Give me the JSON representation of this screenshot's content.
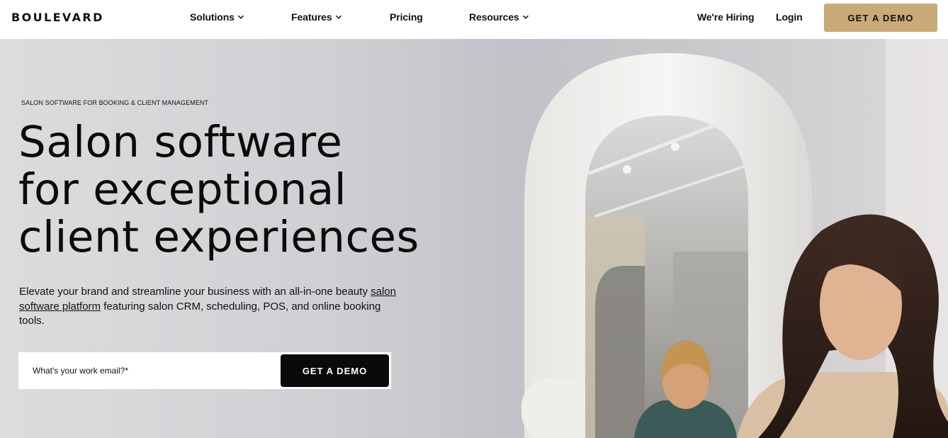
{
  "header": {
    "logo": "BOULEVARD",
    "nav": {
      "solutions": "Solutions",
      "features": "Features",
      "pricing": "Pricing",
      "resources": "Resources",
      "hiring": "We're Hiring",
      "login": "Login"
    },
    "cta": "GET A DEMO"
  },
  "hero": {
    "eyebrow": "SALON SOFTWARE FOR BOOKING & CLIENT MANAGEMENT",
    "headline": [
      "Salon software",
      "for exceptional",
      "client experiences"
    ],
    "subcopy": {
      "before_link": "Elevate your brand and streamline your business with an all-in-one beauty ",
      "link": "salon software platform",
      "after_link": " featuring salon CRM, scheduling, POS, and online booking tools."
    },
    "email_placeholder": "What's your work email?*",
    "form_cta": "GET A DEMO"
  },
  "colors": {
    "accent": "#c9aa78",
    "dark_button": "#0a0a0a",
    "hero_background": "#d2d2d6"
  }
}
